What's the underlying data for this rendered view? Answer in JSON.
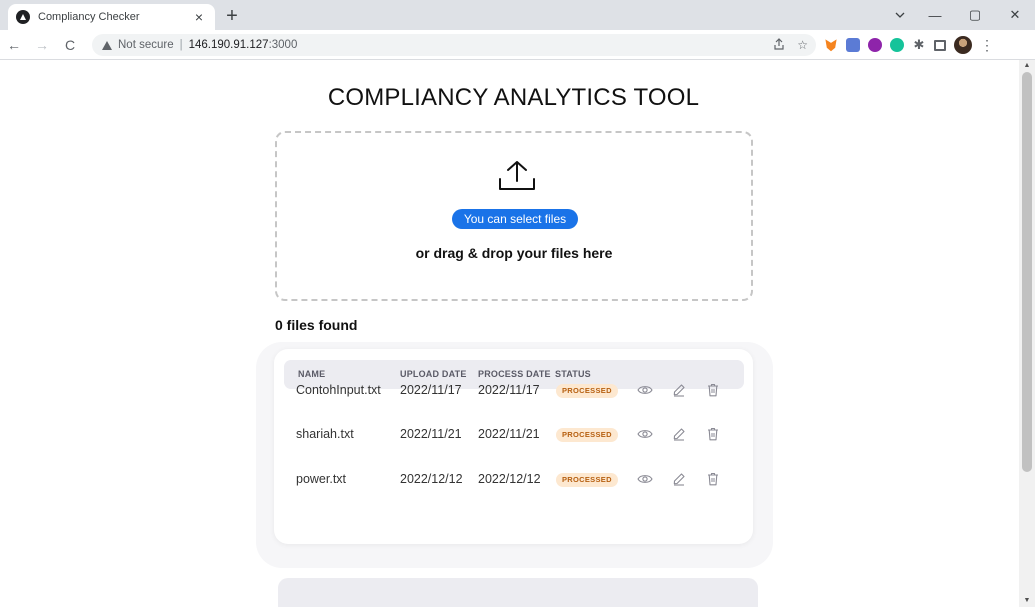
{
  "browser": {
    "tab_title": "Compliancy Checker",
    "tab_close": "×",
    "new_tab": "+",
    "not_secure": "Not secure",
    "url_separator": "|",
    "url_host": "146.190.91.127",
    "url_port": ":3000",
    "win_minimize": "—",
    "win_restore": "▢",
    "win_close": "✕",
    "nav_back": "←",
    "nav_forward": "→",
    "nav_reload": "C"
  },
  "page": {
    "title": "COMPLIANCY ANALYTICS TOOL",
    "select_files_label": "You can select files",
    "drop_text": "or drag & drop your files here",
    "files_found": "0 files found"
  },
  "table": {
    "headers": [
      "NAME",
      "UPLOAD DATE",
      "PROCESS DATE",
      "STATUS"
    ],
    "rows": [
      {
        "name": "ContohInput.txt",
        "upload_date": "2022/11/17",
        "process_date": "2022/11/17",
        "status": "PROCESSED"
      },
      {
        "name": "shariah.txt",
        "upload_date": "2022/11/21",
        "process_date": "2022/11/21",
        "status": "PROCESSED"
      },
      {
        "name": "power.txt",
        "upload_date": "2022/12/12",
        "process_date": "2022/12/12",
        "status": "PROCESSED"
      }
    ]
  },
  "colors": {
    "accent": "#1a73e8",
    "badge_bg": "#fde8d0",
    "badge_text": "#b65f10"
  }
}
